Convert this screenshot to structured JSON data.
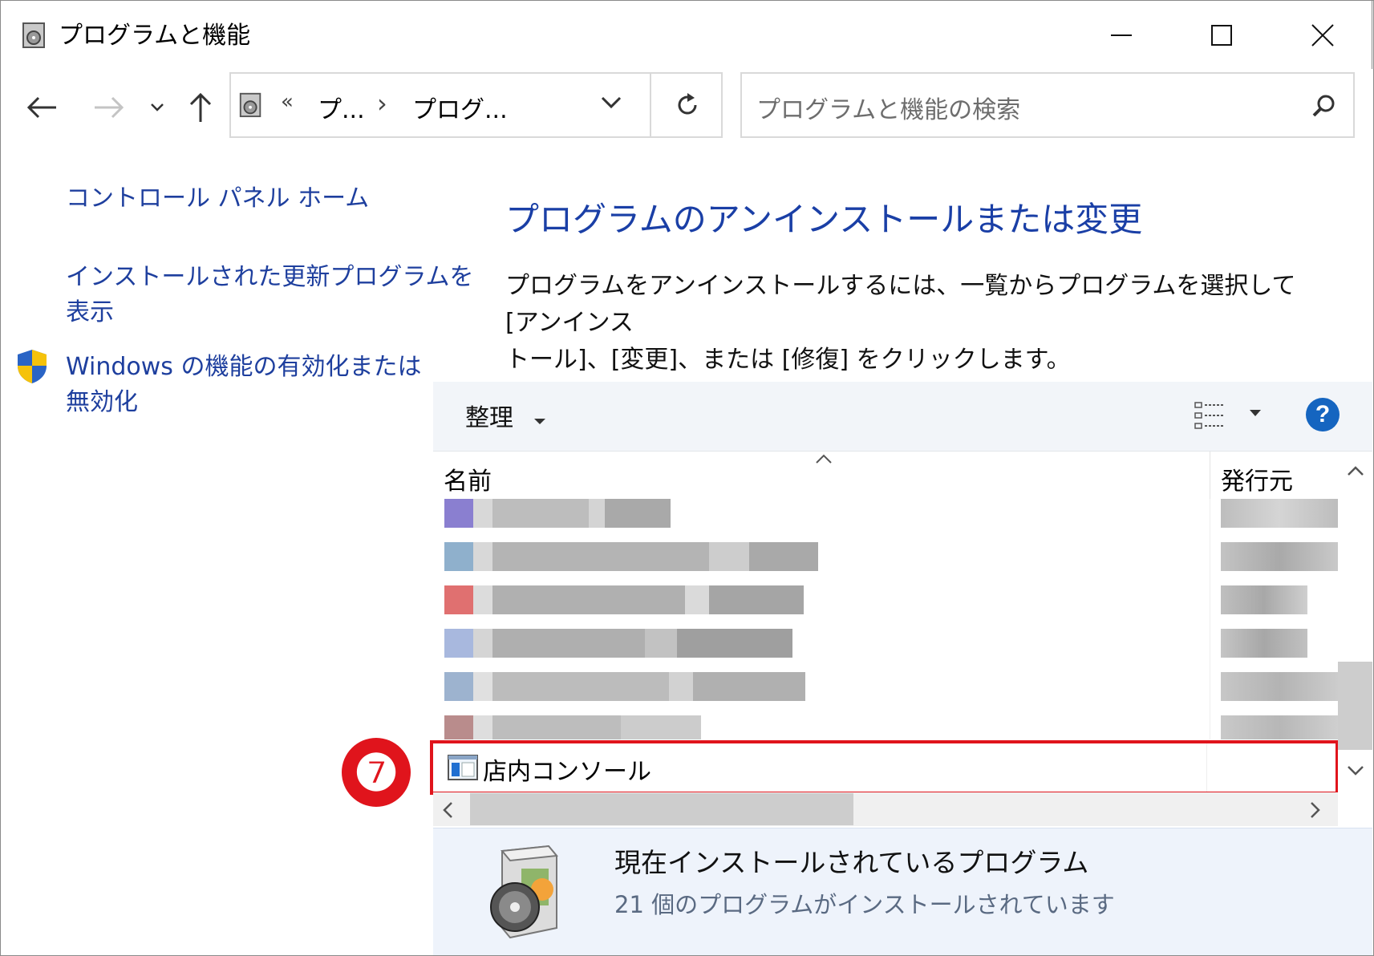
{
  "window": {
    "title": "プログラムと機能",
    "minimize_icon": "minimize-icon",
    "maximize_icon": "maximize-icon",
    "close_icon": "close-icon"
  },
  "nav": {
    "back_icon": "arrow-left-icon",
    "forward_icon": "arrow-right-icon",
    "recent_icon": "chevron-down-icon",
    "up_icon": "arrow-up-icon"
  },
  "address": {
    "overflow": "«",
    "crumbs": [
      "プ...",
      "プログ..."
    ],
    "separator": "›",
    "refresh_icon": "refresh-icon"
  },
  "search": {
    "placeholder": "プログラムと機能の検索",
    "icon": "search-icon"
  },
  "sidebar": {
    "items": [
      {
        "label": "コントロール パネル ホーム"
      },
      {
        "label_line1": "インストールされた更新プログラムを",
        "label_line2": "表示"
      },
      {
        "label_line1": "Windows の機能の有効化または",
        "label_line2": "無効化",
        "icon": "shield-icon"
      }
    ]
  },
  "main": {
    "heading": "プログラムのアンインストールまたは変更",
    "instructions_line1": "プログラムをアンインストールするには、一覧からプログラムを選択して [アンインス",
    "instructions_line2": "トール]、[変更]、または [修復] をクリックします。"
  },
  "toolbar": {
    "organize_label": "整理",
    "view_icon": "view-list-icon",
    "help_icon": "help-icon",
    "help_label": "?"
  },
  "columns": {
    "name": "名前",
    "publisher": "発行元",
    "sort_icon": "sort-up-icon"
  },
  "programs": {
    "blurred_rows": 6,
    "highlighted": {
      "name": "店内コンソール",
      "icon": "app-window-icon"
    }
  },
  "annotation": {
    "badge": "❼"
  },
  "footer": {
    "title": "現在インストールされているプログラム",
    "subtitle": "21 個のプログラムがインストールされています",
    "icon": "installer-disc-icon"
  },
  "colors": {
    "link": "#1e3f9e",
    "heading": "#1a3fa6",
    "highlight": "#e0141c",
    "footer_bg": "#eef3fb"
  }
}
